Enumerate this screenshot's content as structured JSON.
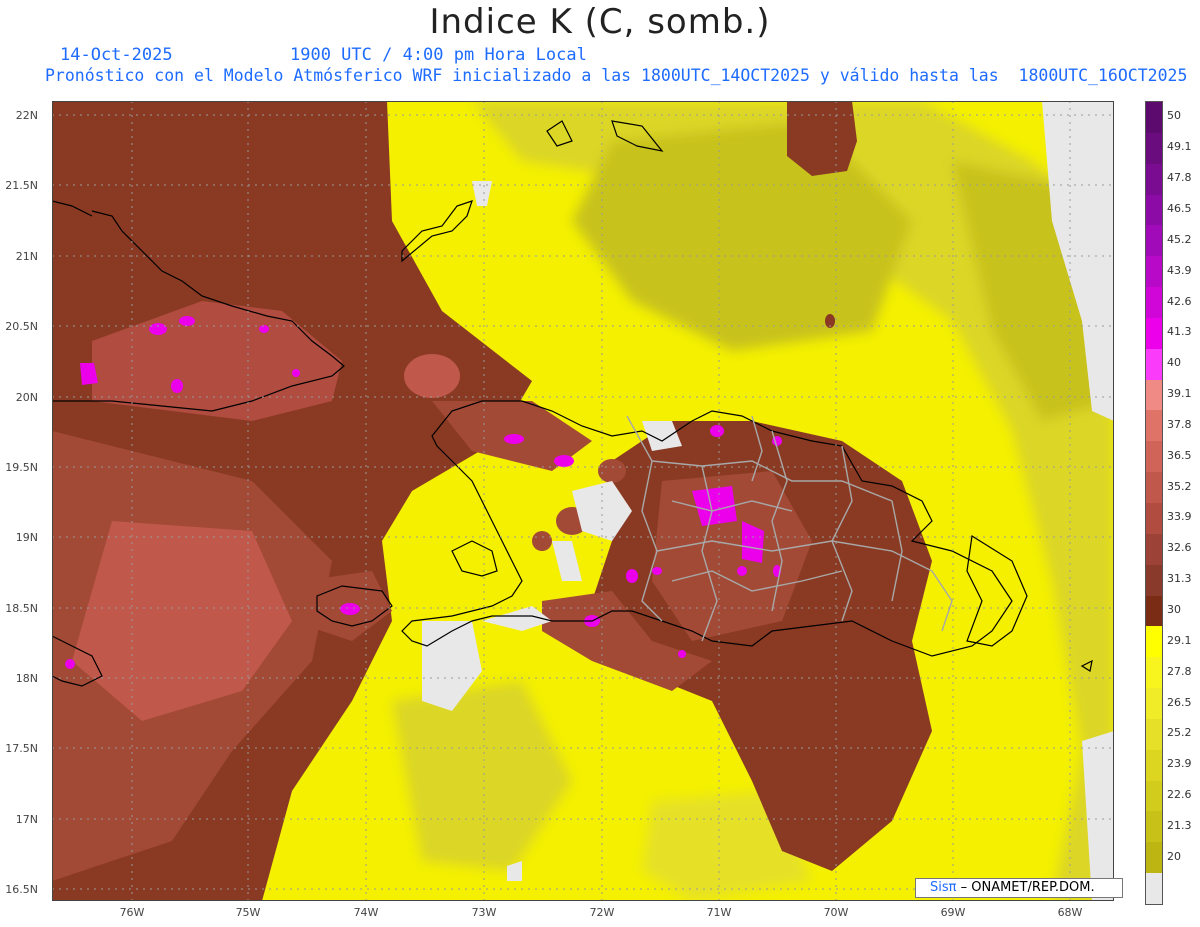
{
  "header": {
    "title": "Indice K (C, somb.)",
    "date": "14-Oct-2025",
    "time": "1900 UTC / 4:00 pm Hora Local",
    "description": "Pronóstico con el Modelo Atmósferico WRF inicializado a las 1800UTC_14OCT2025 y válido hasta las  1800UTC_16OCT2025"
  },
  "axes": {
    "lat_labels": [
      "22N",
      "21.5N",
      "21N",
      "20.5N",
      "20N",
      "19.5N",
      "19N",
      "18.5N",
      "18N",
      "17.5N",
      "17N",
      "16.5N"
    ],
    "lon_labels": [
      "76W",
      "75W",
      "74W",
      "73W",
      "72W",
      "71W",
      "70W",
      "69W",
      "68W"
    ]
  },
  "colorbar": {
    "labels": [
      "50",
      "49.1",
      "47.8",
      "46.5",
      "45.2",
      "43.9",
      "42.6",
      "41.3",
      "40",
      "39.1",
      "37.8",
      "36.5",
      "35.2",
      "33.9",
      "32.6",
      "31.3",
      "30",
      "29.1",
      "27.8",
      "26.5",
      "25.2",
      "23.9",
      "22.6",
      "21.3",
      "20"
    ],
    "colors": [
      "#5c0a6e",
      "#6a0c7e",
      "#7a0c92",
      "#8c0aa6",
      "#a00ab8",
      "#b808c8",
      "#d006d8",
      "#ec00ec",
      "#fa3cfa",
      "#f08a84",
      "#e07368",
      "#d06458",
      "#c0584c",
      "#b04c40",
      "#9c4236",
      "#8a3a2a",
      "#7a2d14",
      "#ffff00",
      "#f8f41e",
      "#f0ec28",
      "#e6e128",
      "#dcd620",
      "#d2cc1c",
      "#c8c218",
      "#bdb612",
      "#e8e8e8"
    ]
  },
  "credit": {
    "sis": "Sisπ",
    "org": "– ONAMET/REP.DOM."
  }
}
